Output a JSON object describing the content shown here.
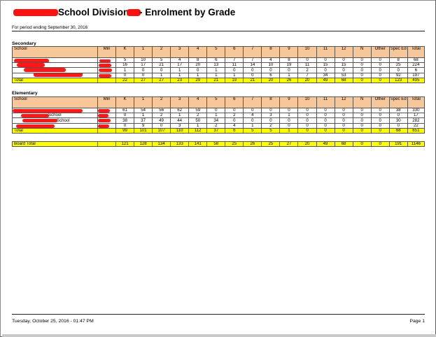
{
  "header": {
    "title_part1": "School Division",
    "title_part2": " - Enrolment by Grade",
    "subtitle": "For period ending September 30, 2016"
  },
  "columns": [
    "School",
    "Min",
    "K",
    "1",
    "2",
    "3",
    "4",
    "5",
    "6",
    "7",
    "8",
    "9",
    "10",
    "11",
    "12",
    "N",
    "Other",
    "Spec Ed",
    "Total"
  ],
  "secondary": {
    "label": "Secondary",
    "rows": [
      {
        "name": "",
        "min": "",
        "values": [
          "5",
          "10",
          "5",
          "4",
          "8",
          "6",
          "7",
          "7",
          "4",
          "8",
          "0",
          "0",
          "0",
          "0",
          "0",
          "8",
          "68"
        ]
      },
      {
        "name": "",
        "min": "",
        "values": [
          "16",
          "17",
          "21",
          "17",
          "20",
          "13",
          "11",
          "14",
          "10",
          "19",
          "11",
          "15",
          "15",
          "0",
          "0",
          "25",
          "224"
        ]
      },
      {
        "name": "",
        "min": "",
        "values": [
          "1",
          "0",
          "0",
          "1",
          "0",
          "1",
          "0",
          "0",
          "0",
          "0",
          "2",
          "0",
          "0",
          "0",
          "0",
          "0",
          "6"
        ]
      },
      {
        "name": "",
        "min": "",
        "values": [
          "0",
          "0",
          "1",
          "1",
          "1",
          "1",
          "1",
          "0",
          "6",
          "1",
          "7",
          "34",
          "53",
          "0",
          "0",
          "92",
          "197"
        ]
      }
    ],
    "total": {
      "label": "Total",
      "values": [
        "22",
        "27",
        "27",
        "23",
        "29",
        "21",
        "19",
        "21",
        "20",
        "26",
        "20",
        "49",
        "68",
        "0",
        "0",
        "123",
        "495"
      ]
    }
  },
  "elementary": {
    "label": "Elementary",
    "rows": [
      {
        "name": "",
        "min": "",
        "values": [
          "61",
          "54",
          "56",
          "62",
          "59",
          "0",
          "0",
          "0",
          "0",
          "0",
          "0",
          "0",
          "0",
          "0",
          "0",
          "38",
          "330"
        ]
      },
      {
        "name": "School",
        "min": "",
        "values": [
          "0",
          "1",
          "2",
          "1",
          "2",
          "1",
          "2",
          "4",
          "3",
          "1",
          "0",
          "0",
          "0",
          "0",
          "0",
          "0",
          "17"
        ]
      },
      {
        "name": "School",
        "min": "",
        "values": [
          "38",
          "37",
          "49",
          "44",
          "50",
          "34",
          "0",
          "0",
          "0",
          "0",
          "0",
          "0",
          "0",
          "0",
          "0",
          "30",
          "282"
        ]
      },
      {
        "name": "",
        "min": "",
        "values": [
          "0",
          "9",
          "0",
          "3",
          "1",
          "2",
          "4",
          "1",
          "2",
          "0",
          "0",
          "0",
          "0",
          "0",
          "0",
          "0",
          "22"
        ]
      }
    ],
    "total": {
      "label": "Total",
      "values": [
        "99",
        "101",
        "107",
        "110",
        "112",
        "37",
        "6",
        "5",
        "5",
        "1",
        "0",
        "0",
        "0",
        "0",
        "0",
        "68",
        "651"
      ]
    }
  },
  "board_total": {
    "label": "Board Total",
    "values": [
      "121",
      "128",
      "134",
      "133",
      "141",
      "58",
      "25",
      "26",
      "25",
      "27",
      "20",
      "49",
      "68",
      "0",
      "0",
      "191",
      "1146"
    ]
  },
  "footer": {
    "timestamp": "Tuesday, October 25, 2016 - 01:47 PM",
    "page": "Page 1"
  },
  "colors": {
    "header_fill": "#f7c699",
    "total_fill": "#ffff00",
    "redaction": "#ff1616"
  }
}
